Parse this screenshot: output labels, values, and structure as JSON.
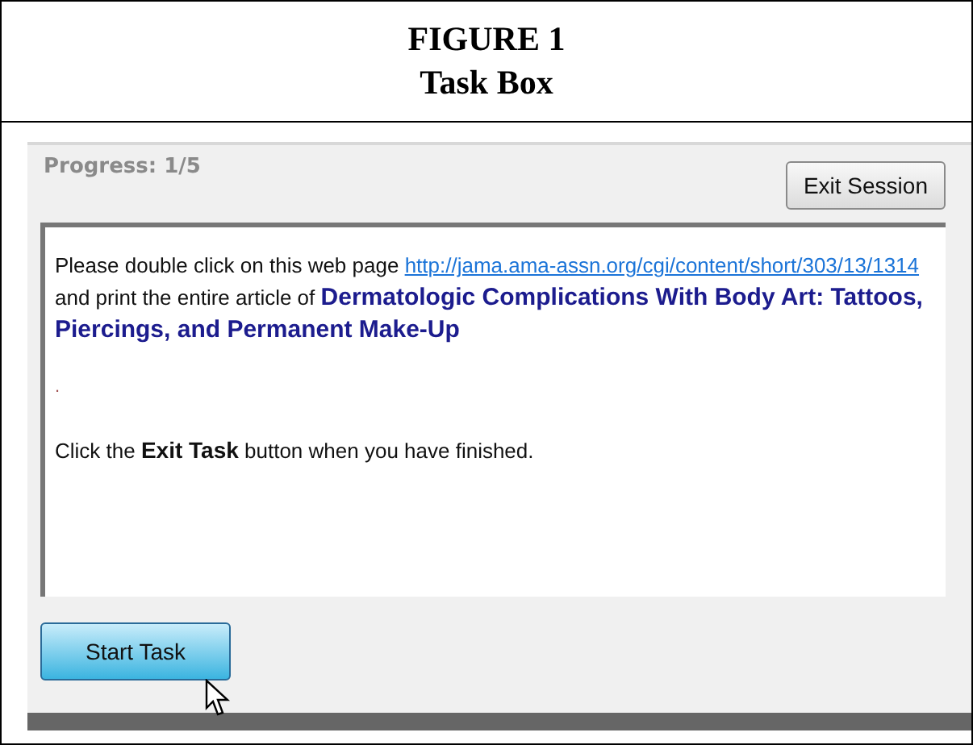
{
  "figure": {
    "label": "FIGURE 1",
    "title": "Task Box"
  },
  "progress": "Progress: 1/5",
  "exit_session_button": "Exit Session",
  "instructions": {
    "text_before": "Please double click on this web page ",
    "link": "http://jama.ama-assn.org/cgi/content/short/303/13/1314",
    "text_after": " and print the entire article of ",
    "article_title": "Dermatologic Complications With Body Art: Tattoos, Piercings, and Permanent Make-Up"
  },
  "separator": ".",
  "closing": "Click the **Exit Task** button when you have finished.",
  "start_task_button": "Start Task"
}
